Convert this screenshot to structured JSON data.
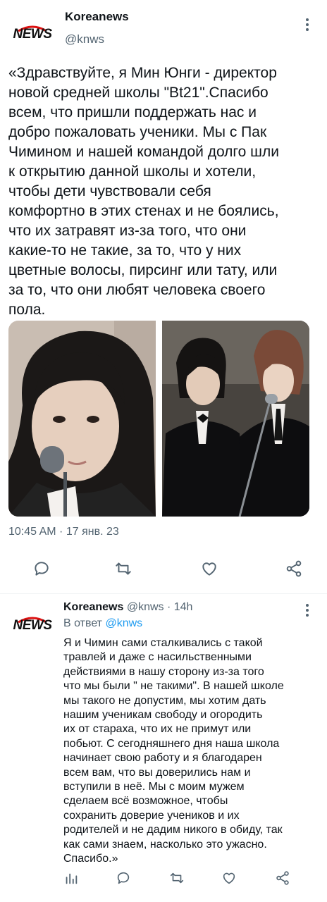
{
  "main_tweet": {
    "author_name": "Koreanews",
    "author_handle": "@knws",
    "avatar_text": "NEWS",
    "text": "«Здравствуйте, я Мин Юнги - директор\nновой средней школы \"Bt21\".Спасибо\nвсем, что пришли поддержать нас и\nдобро пожаловать ученики. Мы с Пак\nЧимином и нашей командой долго шли\nк открытию данной школы и хотели,\nчтобы дети чувствовали себя\nкомфортно в этих стенах и не боялись,\nчто их затравят из-за того, что они\nкакие-то не такие, за то, что у них\nцветные волосы, пирсинг или тату, или\nза то, что они любят человека своего\nпола.",
    "timestamp": "10:45 AM · 17 янв. 23"
  },
  "reply_tweet": {
    "author_name": "Koreanews",
    "meta": "@knws · 14h",
    "avatar_text": "NEWS",
    "reply_prefix": "В ответ",
    "reply_handle": "@knws",
    "text": "Я и Чимин сами сталкивались с такой\nтравлей и даже с насильственными\nдействиями в нашу сторону из-за того\nчто мы были \" не такими\". В нашей школе\nмы такого не допустим, мы хотим дать\nнашим ученикам свободу и огородить\nих от стараха, что их не примут или\nпобьют. С сегодняшнего дня наша школа\nначинает свою работу и я благодарен\nвсем вам, что вы доверились нам и\nвступили в неё. Мы с моим мужем\nсделаем всё возможное, чтобы\nсохранить доверие учеников и их\nродителей и не дадим никого в обиду, так\nкак сами знаем, насколько это ужасно.\nСпасибо.»"
  },
  "icons": [
    "reply-icon",
    "retweet-icon",
    "like-icon",
    "share-icon",
    "analytics-icon",
    "more-icon"
  ],
  "colors": {
    "text": "#0f1419",
    "secondary": "#536471",
    "link": "#1d9bf0",
    "divider": "#eff3f4"
  }
}
